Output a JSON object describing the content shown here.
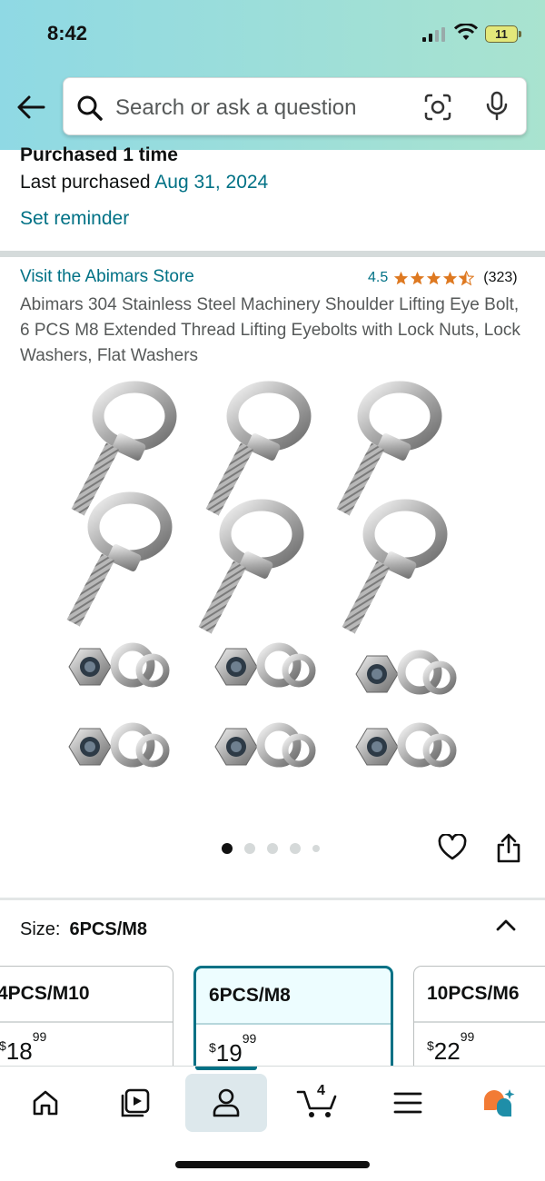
{
  "status_bar": {
    "time": "8:42",
    "battery": "11"
  },
  "search": {
    "placeholder": "Search or ask a question"
  },
  "purchase": {
    "count_text": "Purchased 1 time",
    "last_label": "Last purchased",
    "last_date": "Aug 31, 2024",
    "reminder_label": "Set reminder"
  },
  "product": {
    "store_link": "Visit the Abimars Store",
    "rating_value": "4.5",
    "rating_stars": 4.5,
    "rating_count": "(323)",
    "title": "Abimars 304 Stainless Steel Machinery Shoulder Lifting Eye Bolt, 6 PCS M8 Extended Thread Lifting Eyebolts with Lock Nuts, Lock Washers, Flat Washers",
    "image_count": 5,
    "active_image": 1
  },
  "size": {
    "label": "Size:",
    "selected": "6PCS/M8",
    "options": [
      {
        "label": "4PCS/M10",
        "price_whole": "18",
        "price_fraction": "99",
        "currency": "$"
      },
      {
        "label": "6PCS/M8",
        "price_whole": "19",
        "price_fraction": "99",
        "currency": "$"
      },
      {
        "label": "10PCS/M6",
        "price_whole": "22",
        "price_fraction": "99",
        "currency": "$"
      }
    ]
  },
  "bottom_nav": {
    "cart_count": "4",
    "active": "account"
  },
  "colors": {
    "link": "#007185",
    "star": "#de7921",
    "selected_card_bg": "#edfdff"
  }
}
